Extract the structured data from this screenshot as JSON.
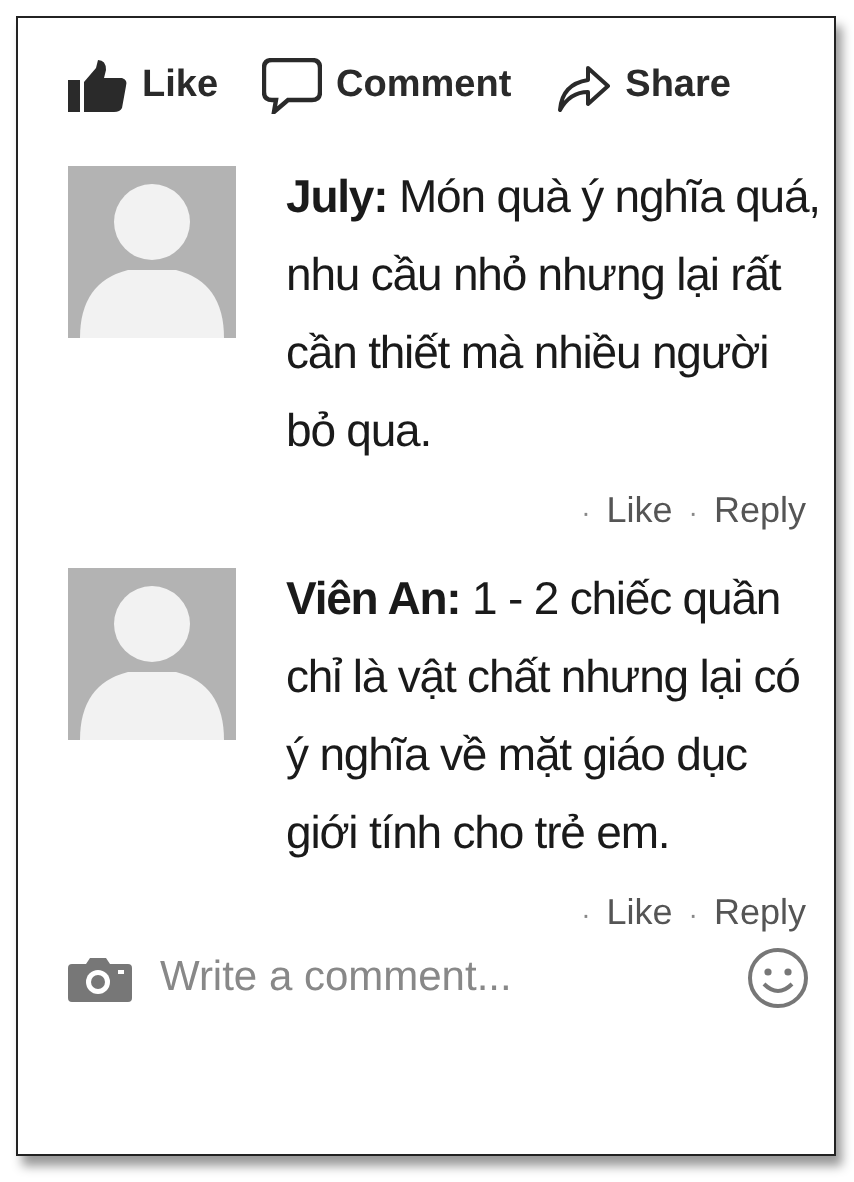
{
  "actions": [
    {
      "kind": "like",
      "label": "Like"
    },
    {
      "kind": "comment",
      "label": "Comment"
    },
    {
      "kind": "share",
      "label": "Share"
    }
  ],
  "comments": [
    {
      "text": "**July:** Món quà ý nghĩa quá, nhu cầu nhỏ nhưng lại rất cần thiết mà nhiều người bỏ qua.",
      "links": [
        {
          "separator": "·",
          "label": "Like"
        },
        {
          "separator": "·",
          "label": "Reply"
        }
      ]
    },
    {
      "text": "**Viên An:** 1 - 2 chiếc quần chỉ là vật chất nhưng lại có ý nghĩa về mặt giáo dục giới tính cho trẻ em.",
      "links": [
        {
          "separator": "·",
          "label": "Like"
        },
        {
          "separator": "·",
          "label": "Reply"
        }
      ]
    }
  ],
  "composer": {
    "placeholder": "Write a comment..."
  }
}
